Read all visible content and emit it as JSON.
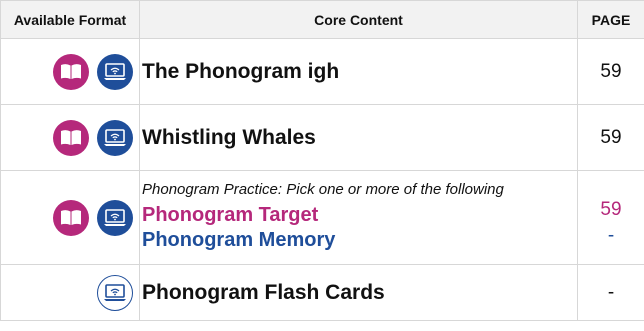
{
  "headers": {
    "format": "Available Format",
    "content": "Core Content",
    "page": "PAGE"
  },
  "rows": [
    {
      "title": "The Phonogram igh",
      "page": "59",
      "formats": [
        "book-icon",
        "online-icon"
      ]
    },
    {
      "title": "Whistling Whales",
      "page": "59",
      "formats": [
        "book-icon",
        "online-icon"
      ]
    },
    {
      "intro": "Phonogram Practice: Pick one or more of the following",
      "option1": "Phonogram Target",
      "option1_page": "59",
      "option2": "Phonogram Memory",
      "option2_page": "-",
      "formats": [
        "book-icon",
        "online-icon"
      ]
    },
    {
      "title": "Phonogram Flash Cards",
      "page": "-",
      "formats": [
        "online-icon"
      ]
    }
  ],
  "colors": {
    "book": "#b5287b",
    "online": "#1f4e9a"
  }
}
